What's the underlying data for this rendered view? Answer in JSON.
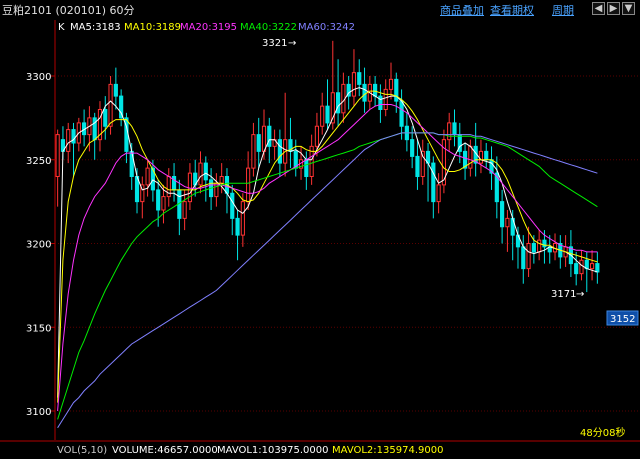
{
  "header": {
    "symbol_title": "豆粕2101 (020101) 60分",
    "menu": [
      "商品叠加",
      "查看期权",
      "周期"
    ],
    "buttons": [
      "◀",
      "▶",
      "▼"
    ]
  },
  "indicators": {
    "chart_type_label": "K",
    "ma": [
      {
        "label": "MA5:3183",
        "color": "#ffffff"
      },
      {
        "label": "MA10:3189",
        "color": "#ffff00"
      },
      {
        "label": "MA20:3195",
        "color": "#ff33ff"
      },
      {
        "label": "MA40:3222",
        "color": "#00ee00"
      },
      {
        "label": "MA60:3242",
        "color": "#8080ff"
      }
    ]
  },
  "annotations": {
    "high_label": "3321",
    "low_label": "3171",
    "last_price": "3152",
    "countdown": "48分08秒"
  },
  "volume_bar": {
    "prefix": "VOL(5,10)",
    "volume": "VOLUME:46657.0000",
    "mavol1": "MAVOL1:103975.0000",
    "mavol2": "MAVOL2:135974.9000"
  },
  "chart_data": {
    "type": "candlestick",
    "yticks": [
      3300,
      3250,
      3200,
      3150,
      3100
    ],
    "ylim": [
      3088,
      3340
    ],
    "candles": [
      [
        3240,
        3265,
        3222,
        3268
      ],
      [
        3262,
        3255,
        3250,
        3270
      ],
      [
        3255,
        3268,
        3248,
        3272
      ],
      [
        3268,
        3260,
        3240,
        3272
      ],
      [
        3260,
        3272,
        3255,
        3275
      ],
      [
        3272,
        3265,
        3258,
        3280
      ],
      [
        3265,
        3275,
        3255,
        3282
      ],
      [
        3275,
        3262,
        3250,
        3278
      ],
      [
        3262,
        3280,
        3255,
        3285
      ],
      [
        3280,
        3270,
        3262,
        3288
      ],
      [
        3270,
        3295,
        3265,
        3300
      ],
      [
        3295,
        3288,
        3280,
        3305
      ],
      [
        3288,
        3275,
        3270,
        3292
      ],
      [
        3275,
        3255,
        3248,
        3278
      ],
      [
        3255,
        3240,
        3232,
        3260
      ],
      [
        3240,
        3225,
        3218,
        3245
      ],
      [
        3225,
        3235,
        3215,
        3240
      ],
      [
        3235,
        3245,
        3228,
        3250
      ],
      [
        3245,
        3232,
        3225,
        3250
      ],
      [
        3232,
        3220,
        3210,
        3238
      ],
      [
        3220,
        3228,
        3212,
        3235
      ],
      [
        3228,
        3240,
        3222,
        3245
      ],
      [
        3240,
        3232,
        3225,
        3248
      ],
      [
        3232,
        3215,
        3205,
        3238
      ],
      [
        3215,
        3225,
        3208,
        3232
      ],
      [
        3225,
        3242,
        3220,
        3248
      ],
      [
        3242,
        3235,
        3228,
        3250
      ],
      [
        3235,
        3248,
        3230,
        3255
      ],
      [
        3248,
        3238,
        3225,
        3252
      ],
      [
        3238,
        3228,
        3220,
        3245
      ],
      [
        3228,
        3236,
        3222,
        3242
      ],
      [
        3236,
        3240,
        3230,
        3248
      ],
      [
        3240,
        3230,
        3218,
        3245
      ],
      [
        3230,
        3215,
        3205,
        3235
      ],
      [
        3215,
        3205,
        3190,
        3220
      ],
      [
        3205,
        3225,
        3198,
        3230
      ],
      [
        3225,
        3245,
        3220,
        3255
      ],
      [
        3245,
        3265,
        3240,
        3272
      ],
      [
        3265,
        3255,
        3245,
        3275
      ],
      [
        3255,
        3270,
        3250,
        3280
      ],
      [
        3270,
        3258,
        3248,
        3275
      ],
      [
        3258,
        3262,
        3250,
        3268
      ],
      [
        3262,
        3248,
        3240,
        3268
      ],
      [
        3248,
        3262,
        3240,
        3290
      ],
      [
        3262,
        3255,
        3245,
        3275
      ],
      [
        3255,
        3245,
        3240,
        3262
      ],
      [
        3245,
        3250,
        3238,
        3258
      ],
      [
        3250,
        3240,
        3232,
        3255
      ],
      [
        3240,
        3258,
        3235,
        3265
      ],
      [
        3258,
        3270,
        3252,
        3278
      ],
      [
        3270,
        3282,
        3265,
        3290
      ],
      [
        3282,
        3272,
        3268,
        3298
      ],
      [
        3272,
        3290,
        3268,
        3321
      ],
      [
        3290,
        3278,
        3270,
        3310
      ],
      [
        3278,
        3295,
        3272,
        3302
      ],
      [
        3295,
        3288,
        3280,
        3300
      ],
      [
        3288,
        3302,
        3282,
        3316
      ],
      [
        3302,
        3295,
        3288,
        3310
      ],
      [
        3295,
        3285,
        3278,
        3305
      ],
      [
        3285,
        3295,
        3280,
        3300
      ],
      [
        3295,
        3288,
        3282,
        3300
      ],
      [
        3288,
        3280,
        3272,
        3295
      ],
      [
        3280,
        3292,
        3276,
        3298
      ],
      [
        3292,
        3298,
        3286,
        3308
      ],
      [
        3298,
        3285,
        3278,
        3302
      ],
      [
        3285,
        3270,
        3262,
        3292
      ],
      [
        3270,
        3262,
        3255,
        3278
      ],
      [
        3262,
        3252,
        3245,
        3270
      ],
      [
        3252,
        3240,
        3232,
        3262
      ],
      [
        3240,
        3255,
        3235,
        3262
      ],
      [
        3255,
        3248,
        3225,
        3260
      ],
      [
        3248,
        3225,
        3215,
        3252
      ],
      [
        3225,
        3235,
        3218,
        3242
      ],
      [
        3235,
        3262,
        3230,
        3268
      ],
      [
        3262,
        3272,
        3255,
        3278
      ],
      [
        3272,
        3265,
        3258,
        3280
      ],
      [
        3265,
        3255,
        3248,
        3272
      ],
      [
        3255,
        3245,
        3238,
        3260
      ],
      [
        3245,
        3258,
        3240,
        3262
      ],
      [
        3258,
        3248,
        3240,
        3272
      ],
      [
        3248,
        3255,
        3242,
        3262
      ],
      [
        3255,
        3250,
        3245,
        3260
      ],
      [
        3250,
        3242,
        3232,
        3258
      ],
      [
        3242,
        3225,
        3215,
        3252
      ],
      [
        3225,
        3210,
        3200,
        3232
      ],
      [
        3210,
        3215,
        3195,
        3220
      ],
      [
        3215,
        3205,
        3190,
        3220
      ],
      [
        3205,
        3198,
        3185,
        3210
      ],
      [
        3198,
        3185,
        3176,
        3205
      ],
      [
        3185,
        3200,
        3180,
        3210
      ],
      [
        3200,
        3195,
        3188,
        3205
      ],
      [
        3195,
        3202,
        3190,
        3208
      ],
      [
        3202,
        3198,
        3188,
        3208
      ],
      [
        3198,
        3195,
        3188,
        3205
      ],
      [
        3195,
        3200,
        3190,
        3206
      ],
      [
        3200,
        3192,
        3185,
        3205
      ],
      [
        3192,
        3198,
        3186,
        3205
      ],
      [
        3198,
        3188,
        3180,
        3208
      ],
      [
        3188,
        3182,
        3175,
        3195
      ],
      [
        3182,
        3190,
        3178,
        3196
      ],
      [
        3190,
        3185,
        3171,
        3195
      ],
      [
        3185,
        3188,
        3178,
        3196
      ],
      [
        3188,
        3183,
        3176,
        3195
      ]
    ],
    "ma_series": [
      {
        "name": "MA5",
        "values": [
          3108,
          3255,
          3260,
          3262,
          3266,
          3268,
          3270,
          3272,
          3275,
          3282,
          3285,
          3282,
          3278,
          3270,
          3255,
          3240,
          3232,
          3233,
          3238,
          3236,
          3232,
          3230,
          3230,
          3228,
          3229,
          3230,
          3235,
          3240,
          3242,
          3240,
          3237,
          3234,
          3230,
          3225,
          3220,
          3218,
          3222,
          3230,
          3245,
          3255,
          3262,
          3262,
          3258,
          3256,
          3255,
          3256,
          3254,
          3250,
          3250,
          3256,
          3262,
          3268,
          3275,
          3282,
          3285,
          3290,
          3292,
          3293,
          3292,
          3290,
          3288,
          3286,
          3287,
          3288,
          3288,
          3285,
          3280,
          3272,
          3262,
          3252,
          3248,
          3242,
          3236,
          3238,
          3245,
          3252,
          3258,
          3260,
          3258,
          3254,
          3250,
          3249,
          3248,
          3244,
          3236,
          3225,
          3215,
          3205,
          3198,
          3195,
          3194,
          3195,
          3196,
          3198,
          3197,
          3196,
          3195,
          3193,
          3190,
          3187,
          3185,
          3184,
          3183
        ]
      },
      {
        "name": "MA10",
        "values": [
          3105,
          3190,
          3225,
          3240,
          3250,
          3255,
          3260,
          3262,
          3265,
          3268,
          3272,
          3274,
          3274,
          3274,
          3270,
          3264,
          3256,
          3250,
          3244,
          3238,
          3234,
          3232,
          3232,
          3232,
          3232,
          3232,
          3232,
          3234,
          3235,
          3236,
          3236,
          3236,
          3235,
          3233,
          3230,
          3226,
          3225,
          3226,
          3230,
          3236,
          3242,
          3248,
          3252,
          3255,
          3256,
          3258,
          3258,
          3256,
          3255,
          3255,
          3258,
          3262,
          3266,
          3270,
          3274,
          3278,
          3282,
          3286,
          3289,
          3291,
          3291,
          3290,
          3289,
          3289,
          3288,
          3286,
          3283,
          3279,
          3274,
          3268,
          3262,
          3256,
          3250,
          3245,
          3243,
          3243,
          3244,
          3246,
          3248,
          3250,
          3250,
          3250,
          3250,
          3248,
          3244,
          3238,
          3230,
          3222,
          3214,
          3207,
          3202,
          3200,
          3199,
          3199,
          3197,
          3196,
          3195,
          3194,
          3193,
          3192,
          3191,
          3190,
          3189
        ]
      },
      {
        "name": "MA20",
        "values": [
          3100,
          3140,
          3170,
          3190,
          3205,
          3215,
          3222,
          3228,
          3232,
          3236,
          3242,
          3248,
          3252,
          3254,
          3254,
          3254,
          3252,
          3250,
          3247,
          3244,
          3242,
          3240,
          3238,
          3236,
          3234,
          3233,
          3233,
          3233,
          3234,
          3235,
          3235,
          3235,
          3234,
          3233,
          3232,
          3231,
          3230,
          3230,
          3231,
          3233,
          3236,
          3238,
          3240,
          3242,
          3244,
          3246,
          3248,
          3250,
          3252,
          3254,
          3256,
          3258,
          3260,
          3262,
          3265,
          3268,
          3271,
          3274,
          3277,
          3280,
          3282,
          3283,
          3283,
          3283,
          3282,
          3280,
          3278,
          3275,
          3272,
          3269,
          3266,
          3263,
          3260,
          3257,
          3255,
          3253,
          3252,
          3251,
          3250,
          3249,
          3247,
          3245,
          3243,
          3240,
          3236,
          3232,
          3228,
          3224,
          3220,
          3216,
          3212,
          3208,
          3205,
          3203,
          3201,
          3199,
          3198,
          3197,
          3196,
          3196,
          3195,
          3195,
          3195
        ]
      },
      {
        "name": "MA40",
        "values": [
          3095,
          3105,
          3115,
          3125,
          3135,
          3142,
          3150,
          3158,
          3165,
          3172,
          3178,
          3184,
          3190,
          3195,
          3200,
          3204,
          3207,
          3210,
          3213,
          3215,
          3218,
          3220,
          3222,
          3224,
          3226,
          3228,
          3230,
          3231,
          3232,
          3233,
          3234,
          3235,
          3236,
          3236,
          3236,
          3236,
          3236,
          3237,
          3238,
          3239,
          3240,
          3241,
          3242,
          3243,
          3244,
          3245,
          3246,
          3247,
          3248,
          3249,
          3250,
          3251,
          3252,
          3253,
          3254,
          3255,
          3256,
          3258,
          3259,
          3260,
          3261,
          3262,
          3263,
          3264,
          3265,
          3266,
          3266,
          3266,
          3266,
          3266,
          3266,
          3266,
          3265,
          3265,
          3264,
          3264,
          3264,
          3264,
          3264,
          3263,
          3263,
          3262,
          3261,
          3260,
          3259,
          3258,
          3256,
          3254,
          3252,
          3250,
          3248,
          3246,
          3243,
          3240,
          3238,
          3236,
          3234,
          3232,
          3230,
          3228,
          3226,
          3224,
          3222
        ]
      },
      {
        "name": "MA60",
        "values": [
          3090,
          3095,
          3100,
          3105,
          3108,
          3112,
          3115,
          3118,
          3122,
          3125,
          3128,
          3131,
          3134,
          3137,
          3140,
          3142,
          3144,
          3146,
          3148,
          3150,
          3152,
          3154,
          3156,
          3158,
          3160,
          3162,
          3164,
          3166,
          3168,
          3170,
          3172,
          3175,
          3178,
          3181,
          3184,
          3187,
          3190,
          3193,
          3196,
          3199,
          3202,
          3205,
          3208,
          3211,
          3214,
          3217,
          3220,
          3223,
          3226,
          3229,
          3232,
          3235,
          3238,
          3241,
          3244,
          3247,
          3250,
          3253,
          3256,
          3258,
          3260,
          3262,
          3263,
          3264,
          3265,
          3266,
          3266,
          3266,
          3266,
          3266,
          3266,
          3266,
          3265,
          3265,
          3265,
          3265,
          3265,
          3265,
          3265,
          3264,
          3264,
          3263,
          3262,
          3261,
          3260,
          3259,
          3258,
          3257,
          3256,
          3255,
          3254,
          3253,
          3252,
          3251,
          3250,
          3249,
          3248,
          3247,
          3246,
          3245,
          3244,
          3243,
          3242
        ]
      }
    ]
  }
}
